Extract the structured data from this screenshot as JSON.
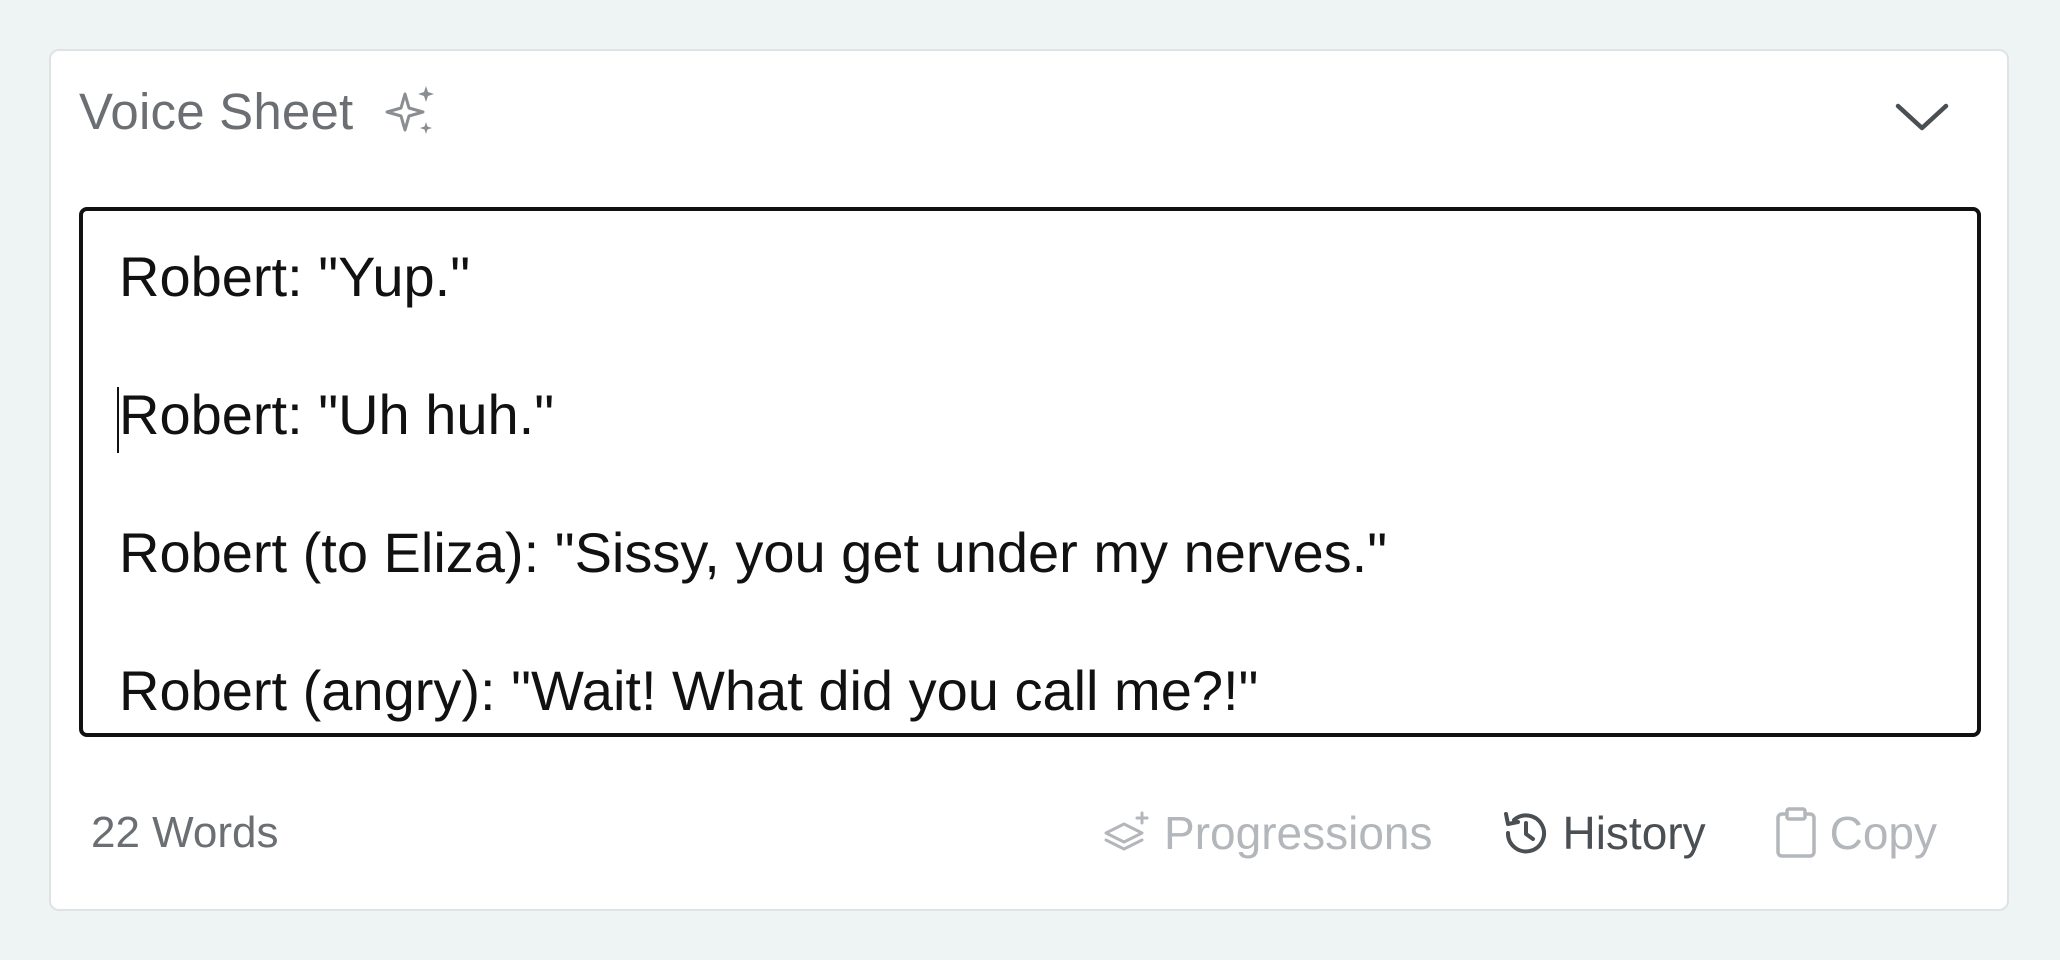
{
  "panel": {
    "title": "Voice Sheet",
    "title_icon": "sparkle-icon",
    "collapse_icon": "chevron-down-icon"
  },
  "editor": {
    "lines": [
      "Robert: \"Yup.\"",
      "Robert: \"Uh huh.\"",
      "Robert (to Eliza): \"Sissy, you get under my nerves.\"",
      "Robert (angry): \"Wait! What did you call me?!\""
    ]
  },
  "footer": {
    "word_count": "22 Words",
    "progressions_label": "Progressions",
    "history_label": "History",
    "copy_label": "Copy"
  },
  "colors": {
    "background": "#eef3f3",
    "card": "#ffffff",
    "text": "#111111",
    "muted": "#6b6f73",
    "disabled": "#b3b7bb"
  }
}
